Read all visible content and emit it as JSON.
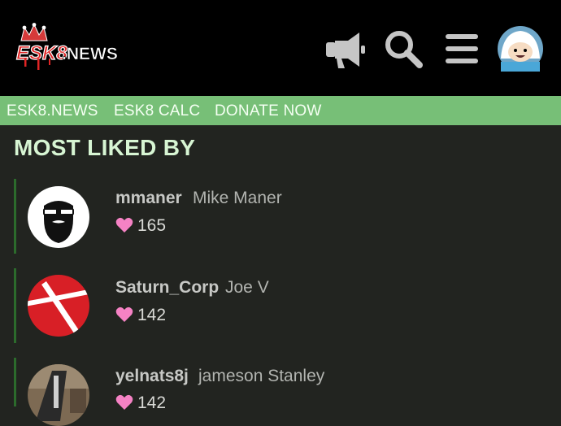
{
  "header": {
    "logo_text": "ESK8.NEWS",
    "icons": [
      "megaphone-icon",
      "search-icon",
      "hamburger-menu-icon",
      "user-avatar"
    ]
  },
  "nav": {
    "items": [
      "ESK8.NEWS",
      "ESK8 CALC",
      "DONATE NOW"
    ]
  },
  "page": {
    "title": "MOST LIKED BY"
  },
  "likers": [
    {
      "username": "mmaner",
      "full_name": "Mike Maner",
      "likes": "165"
    },
    {
      "username": "Saturn_Corp",
      "full_name": "Joe V",
      "likes": "142"
    },
    {
      "username": "yelnats8j",
      "full_name": "jameson Stanley",
      "likes": "142"
    }
  ],
  "colors": {
    "header_bg": "#000000",
    "nav_bg": "#77bf77",
    "page_bg": "#222420",
    "heading": "#d7f5d3",
    "row_bar": "#2c6b2c",
    "heart": "#f582c4"
  }
}
